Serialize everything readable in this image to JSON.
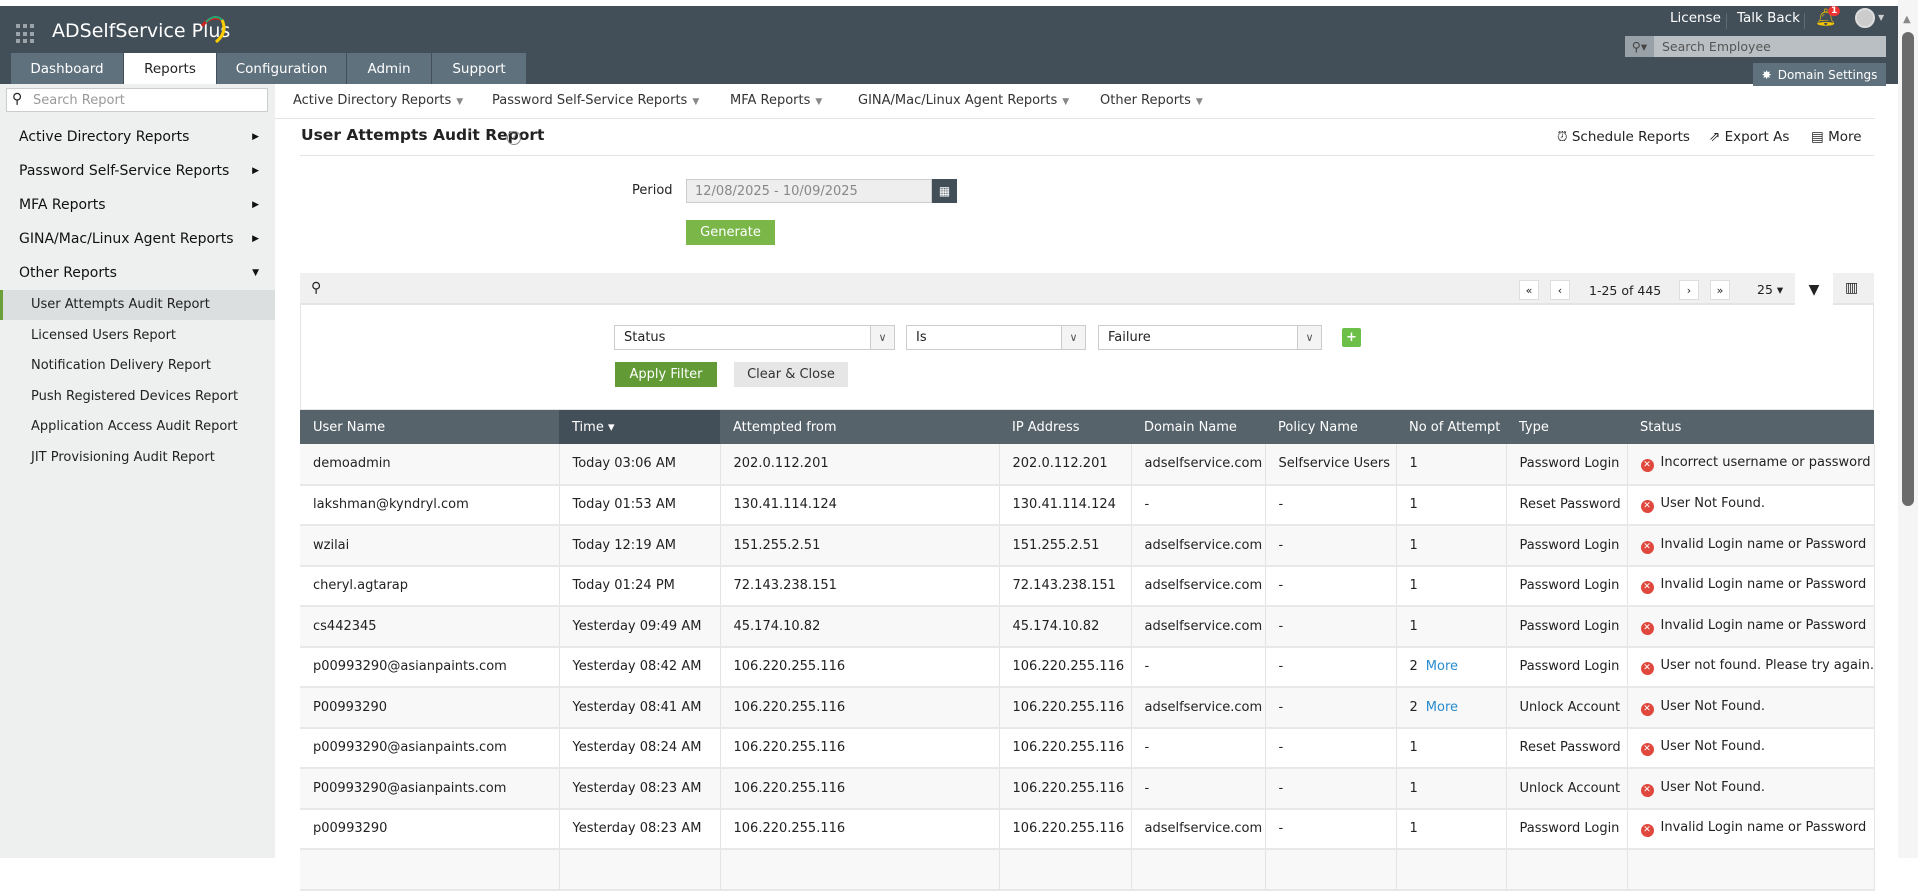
{
  "app": {
    "title": "ADSelfService Plus"
  },
  "header": {
    "license": "License",
    "talk_back": "Talk Back",
    "notification_count": "1",
    "search_placeholder": "Search Employee",
    "domain_settings": "Domain Settings"
  },
  "tabs": [
    {
      "label": "Dashboard"
    },
    {
      "label": "Reports",
      "active": true
    },
    {
      "label": "Configuration"
    },
    {
      "label": "Admin"
    },
    {
      "label": "Support"
    }
  ],
  "sidebar": {
    "search_placeholder": "Search Report",
    "categories": [
      {
        "label": "Active Directory Reports"
      },
      {
        "label": "Password Self-Service Reports"
      },
      {
        "label": "MFA Reports"
      },
      {
        "label": "GINA/Mac/Linux Agent Reports"
      },
      {
        "label": "Other Reports"
      }
    ],
    "sub_items": [
      {
        "label": "User Attempts Audit Report",
        "selected": true
      },
      {
        "label": "Licensed Users Report"
      },
      {
        "label": "Notification Delivery Report"
      },
      {
        "label": "Push Registered Devices Report"
      },
      {
        "label": "Application Access Audit Report"
      },
      {
        "label": "JIT Provisioning Audit Report"
      }
    ]
  },
  "topnav": [
    {
      "label": "Active Directory Reports"
    },
    {
      "label": "Password Self-Service Reports"
    },
    {
      "label": "MFA Reports"
    },
    {
      "label": "GINA/Mac/Linux Agent Reports"
    },
    {
      "label": "Other Reports"
    }
  ],
  "report": {
    "title": "User Attempts Audit Report",
    "schedule": "Schedule Reports",
    "export": "Export As",
    "more": "More",
    "period_label": "Period",
    "period_value": "12/08/2025 - 10/09/2025",
    "generate": "Generate"
  },
  "pagination": {
    "range": "1-25 of 445",
    "page_size": "25"
  },
  "filter": {
    "field": "Status",
    "operator": "Is",
    "value": "Failure",
    "apply": "Apply Filter",
    "clear": "Clear & Close"
  },
  "table": {
    "columns": [
      "User Name",
      "Time",
      "Attempted from",
      "IP Address",
      "Domain Name",
      "Policy Name",
      "No of Attempt",
      "Type",
      "Status"
    ],
    "sorted_column": "Time",
    "more_label": "More",
    "rows": [
      [
        "demoadmin",
        "Today 03:06 AM",
        "202.0.112.201",
        "202.0.112.201",
        "adselfservice.com",
        "Selfservice Users",
        "1",
        "Password Login",
        "Incorrect username or password"
      ],
      [
        "lakshman@kyndryl.com",
        "Today 01:53 AM",
        "130.41.114.124",
        "130.41.114.124",
        "-",
        "-",
        "1",
        "Reset Password",
        "User Not Found."
      ],
      [
        "wzilai",
        "Today 12:19 AM",
        "151.255.2.51",
        "151.255.2.51",
        "adselfservice.com",
        "-",
        "1",
        "Password Login",
        "Invalid Login name or Password"
      ],
      [
        "cheryl.agtarap",
        "Today 01:24 PM",
        "72.143.238.151",
        "72.143.238.151",
        "adselfservice.com",
        "-",
        "1",
        "Password Login",
        "Invalid Login name or Password"
      ],
      [
        "cs442345",
        "Yesterday 09:49 AM",
        "45.174.10.82",
        "45.174.10.82",
        "adselfservice.com",
        "-",
        "1",
        "Password Login",
        "Invalid Login name or Password"
      ],
      [
        "p00993290@asianpaints.com",
        "Yesterday 08:42 AM",
        "106.220.255.116",
        "106.220.255.116",
        "-",
        "-",
        "2",
        "Password Login",
        "User not found. Please try again."
      ],
      [
        "P00993290",
        "Yesterday 08:41 AM",
        "106.220.255.116",
        "106.220.255.116",
        "adselfservice.com",
        "-",
        "2",
        "Unlock Account",
        "User Not Found."
      ],
      [
        "p00993290@asianpaints.com",
        "Yesterday 08:24 AM",
        "106.220.255.116",
        "106.220.255.116",
        "-",
        "-",
        "1",
        "Reset Password",
        "User Not Found."
      ],
      [
        "P00993290@asianpaints.com",
        "Yesterday 08:23 AM",
        "106.220.255.116",
        "106.220.255.116",
        "-",
        "-",
        "1",
        "Unlock Account",
        "User Not Found."
      ],
      [
        "p00993290",
        "Yesterday 08:23 AM",
        "106.220.255.116",
        "106.220.255.116",
        "adselfservice.com",
        "-",
        "1",
        "Password Login",
        "Invalid Login name or Password"
      ]
    ]
  },
  "colors": {
    "header_bg": "#434f58",
    "tab_bg": "#5f717d",
    "accent_green": "#6a9f3a",
    "error_red": "#e0483e",
    "link_blue": "#2a8ccf"
  }
}
